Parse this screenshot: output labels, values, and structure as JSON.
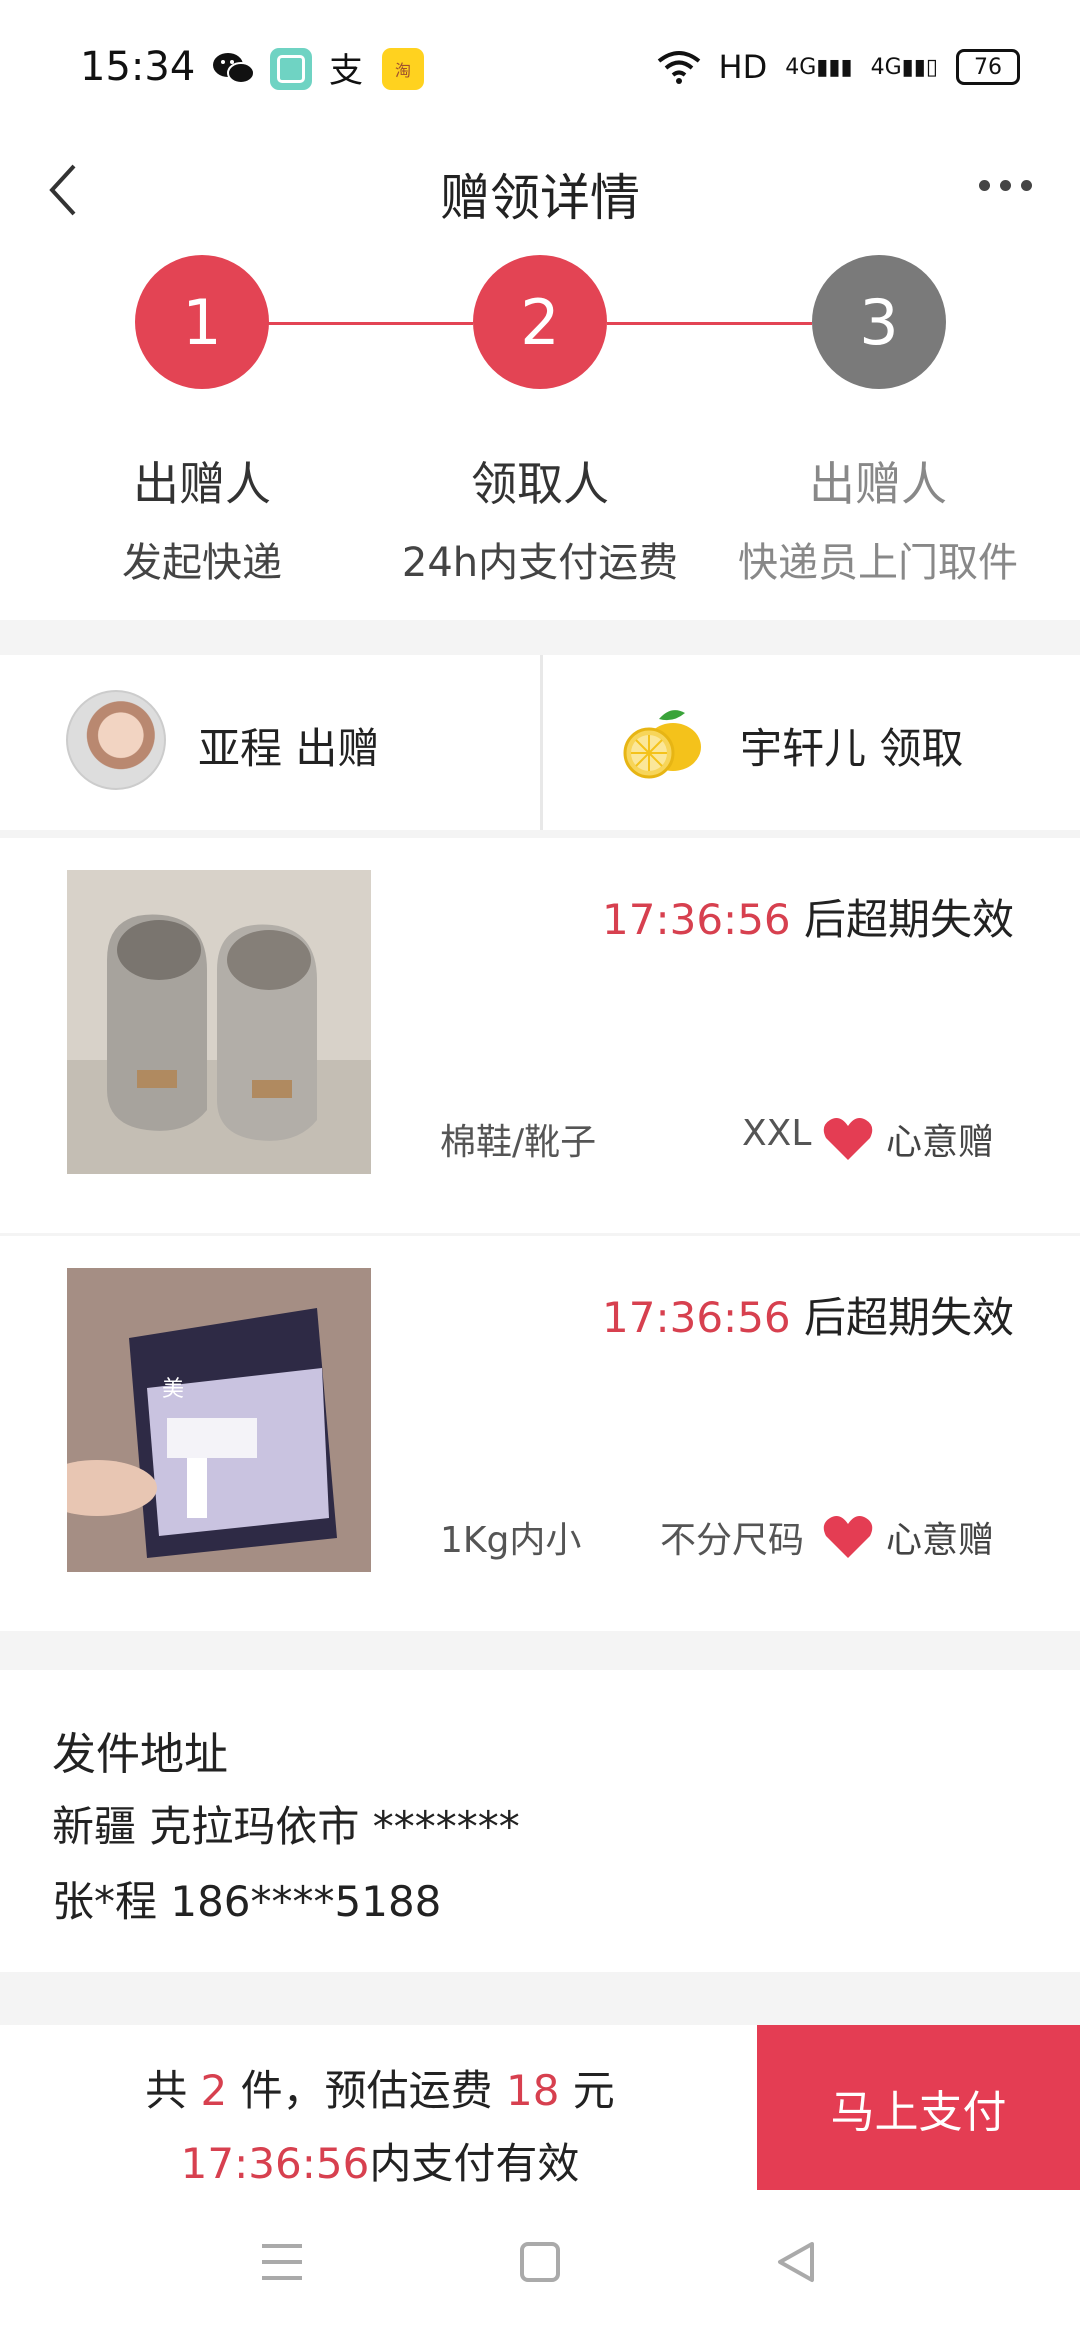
{
  "status_bar": {
    "time": "15:34",
    "network": "HD",
    "signal1": "4G",
    "signal2": "4G",
    "battery": "76",
    "icons": [
      "wechat-icon",
      "app-icon",
      "alipay-icon",
      "taobao-icon",
      "wifi-icon"
    ]
  },
  "nav": {
    "title": "赠领详情",
    "back_icon": "back-arrow-icon",
    "more_icon": "more-dots-icon"
  },
  "steps": [
    {
      "number": "1",
      "title": "出赠人",
      "subtitle": "发起快递",
      "state": "done"
    },
    {
      "number": "2",
      "title": "领取人",
      "subtitle": "24h内支付运费",
      "state": "active"
    },
    {
      "number": "3",
      "title": "出赠人",
      "subtitle": "快递员上门取件",
      "state": "pending"
    }
  ],
  "colors": {
    "accent": "#e34454",
    "inactive": "#7a7a7a",
    "countdown": "#d7404f"
  },
  "users": {
    "giver": {
      "name": "亚程",
      "action": "出赠",
      "label": "亚程 出赠"
    },
    "receiver": {
      "name": "宇轩儿",
      "action": "领取",
      "label": "宇轩儿 领取"
    }
  },
  "items": [
    {
      "countdown": "17:36:56",
      "countdown_suffix": " 后超期失效",
      "category": "棉鞋/靴子",
      "size": "XXL",
      "tag": "心意赠",
      "image": "snow-boots-photo"
    },
    {
      "countdown": "17:36:56",
      "countdown_suffix": " 后超期失效",
      "category": "1Kg内小",
      "size": "不分尺码",
      "tag": "心意赠",
      "image": "cotton-pads-photo"
    }
  ],
  "address": {
    "title": "发件地址",
    "line1": "新疆 克拉玛依市 *******",
    "line2": "张*程 186****5188"
  },
  "bottom": {
    "count_prefix": "共 ",
    "count": "2",
    "count_mid": " 件，预估运费 ",
    "fee": "18",
    "fee_suffix": " 元",
    "deadline": "17:36:56",
    "deadline_suffix": "内支付有效",
    "pay_button": "马上支付"
  }
}
